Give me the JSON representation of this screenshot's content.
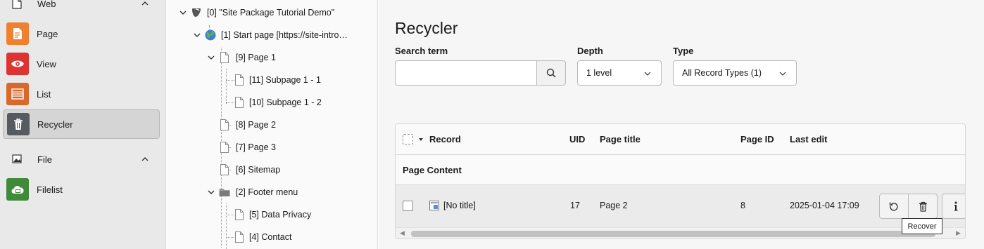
{
  "module_menu": {
    "web_group": {
      "label": "Web"
    },
    "items": [
      {
        "label": "Page",
        "icon": "page-module-icon",
        "color": "#f08030"
      },
      {
        "label": "View",
        "icon": "eye-icon",
        "color": "#dd3333"
      },
      {
        "label": "List",
        "icon": "list-icon",
        "color": "#d9682c"
      },
      {
        "label": "Recycler",
        "icon": "trash-icon",
        "color": "#555b60",
        "active": true
      }
    ],
    "file_group": {
      "label": "File"
    },
    "file_items": [
      {
        "label": "Filelist",
        "icon": "cloud-folder-icon",
        "color": "#3f8b3a"
      }
    ]
  },
  "page_tree": {
    "nodes": [
      {
        "label": "[0] \"Site Package Tutorial Demo\"",
        "icon": "typo3-icon"
      },
      {
        "label": "[1] Start page [https://site-intro…",
        "icon": "globe-icon"
      },
      {
        "label": "[9] Page 1",
        "icon": "page-icon"
      },
      {
        "label": "[11] Subpage 1 - 1",
        "icon": "page-icon"
      },
      {
        "label": "[10] Subpage 1 - 2",
        "icon": "page-icon"
      },
      {
        "label": "[8] Page 2",
        "icon": "page-icon"
      },
      {
        "label": "[7] Page 3",
        "icon": "page-icon"
      },
      {
        "label": "[6] Sitemap",
        "icon": "page-icon"
      },
      {
        "label": "[2] Footer menu",
        "icon": "folder-icon"
      },
      {
        "label": "[5] Data Privacy",
        "icon": "page-icon"
      },
      {
        "label": "[4] Contact",
        "icon": "page-icon"
      }
    ]
  },
  "main": {
    "title": "Recycler",
    "search": {
      "label": "Search term",
      "value": "",
      "placeholder": ""
    },
    "depth": {
      "label": "Depth",
      "value": "1 level"
    },
    "type": {
      "label": "Type",
      "value": "All Record Types (1)"
    },
    "table": {
      "headers": {
        "record": "Record",
        "uid": "UID",
        "page_title": "Page title",
        "page_id": "Page ID",
        "last_edit": "Last edit"
      },
      "group": "Page Content",
      "rows": [
        {
          "record": "[No title]",
          "uid": "17",
          "page_title": "Page 2",
          "page_id": "8",
          "last_edit": "2025-01-04 17:09"
        }
      ]
    },
    "tooltip": "Recover"
  }
}
